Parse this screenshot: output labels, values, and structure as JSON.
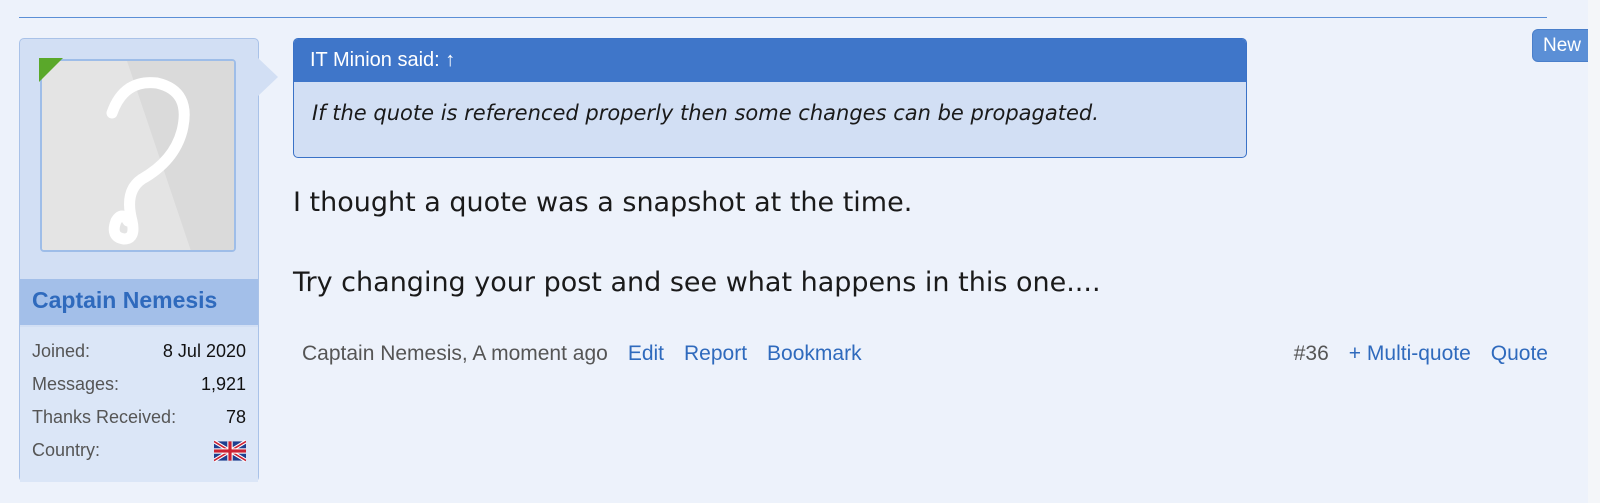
{
  "user": {
    "name": "Captain Nemesis",
    "extras": [
      {
        "label": "Joined:",
        "value": "8 Jul 2020"
      },
      {
        "label": "Messages:",
        "value": "1,921"
      },
      {
        "label": "Thanks Received:",
        "value": "78"
      },
      {
        "label": "Country:",
        "value": "",
        "icon": "uk-flag-icon"
      }
    ]
  },
  "quote": {
    "header": "IT Minion said:",
    "arrow": "↑",
    "text": "If the quote is referenced properly then some changes can be propagated."
  },
  "message": {
    "paragraphs": [
      "I thought a quote was a snapshot at the time.",
      "Try changing your post and see what happens in this one...."
    ]
  },
  "footer": {
    "author_time": "Captain Nemesis, A moment ago",
    "edit": "Edit",
    "report": "Report",
    "bookmark": "Bookmark",
    "post_number": "#36",
    "multiquote": "+ Multi-quote",
    "quote": "Quote"
  },
  "new_badge": "New",
  "colors": {
    "accent": "#3f76c9",
    "link": "#2f6abd",
    "panel": "#d2dff4",
    "page_bg": "#edf2fb",
    "online": "#5aa82a"
  }
}
